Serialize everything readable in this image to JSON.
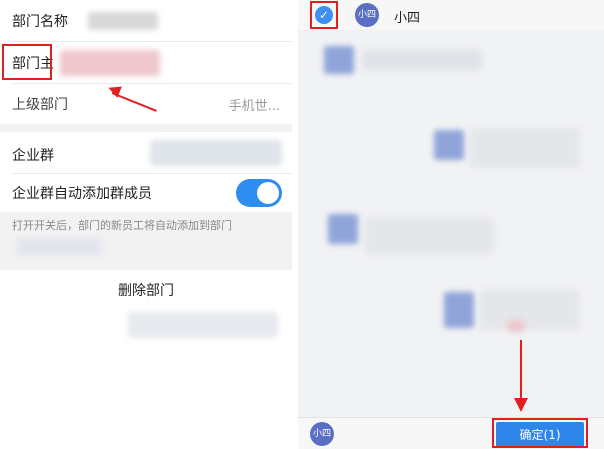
{
  "left": {
    "rows": {
      "name_label": "部门名称",
      "head_label": "部门主",
      "parent_label": "上级部门",
      "parent_value": "手机世...",
      "group_label": "企业群",
      "auto_add_label": "企业群自动添加群成员",
      "auto_add_enabled": true
    },
    "hint": "打开开关后，部门的新员工将自动添加到部门",
    "delete_label": "删除部门"
  },
  "right": {
    "header": {
      "avatar_text": "小四",
      "name": "小四",
      "check_icon": "check-circle-icon"
    },
    "footer": {
      "avatar_text": "小四",
      "confirm_label": "确定(1)"
    }
  },
  "colors": {
    "accent": "#2f86ea",
    "toggle_on": "#2f8cf0",
    "annotation_red": "#e02020",
    "avatar": "#5a6fc4"
  }
}
